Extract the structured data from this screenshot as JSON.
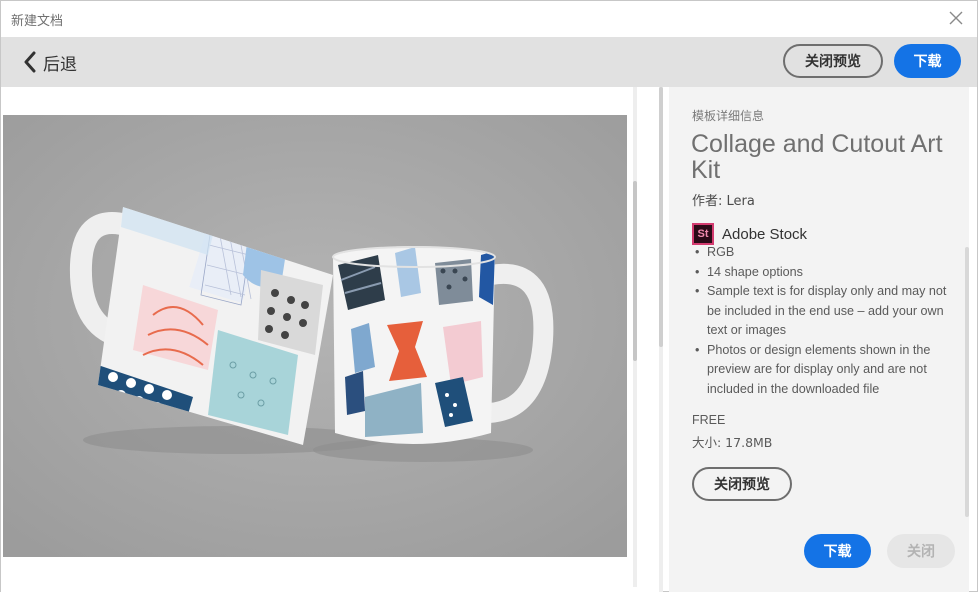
{
  "window": {
    "title": "新建文档"
  },
  "toolbar": {
    "back_label": "后退",
    "close_preview_label": "关闭预览",
    "download_label": "下载"
  },
  "details": {
    "section_label": "模板详细信息",
    "name": "Collage and Cutout Art Kit",
    "author": "作者: Lera",
    "source_badge": "St",
    "source_name": "Adobe Stock",
    "features": [
      "RGB",
      "14 shape options",
      "Sample text is for display only and may not be included in the end use – add your own text or images",
      "Photos or design elements shown in the preview are for display only and are not included in the downloaded file"
    ],
    "price": "FREE",
    "size": "大小: 17.8MB",
    "close_preview_label": "关闭预览",
    "download_label": "下载",
    "close_label": "关闭"
  },
  "colors": {
    "accent": "#1473e6",
    "preview_background": "#a7a7a7",
    "panel_background": "#f3f3f3",
    "toolbar_background": "#e1e1e1"
  },
  "icons": {
    "back": "chevron-left-icon",
    "close": "close-icon"
  }
}
